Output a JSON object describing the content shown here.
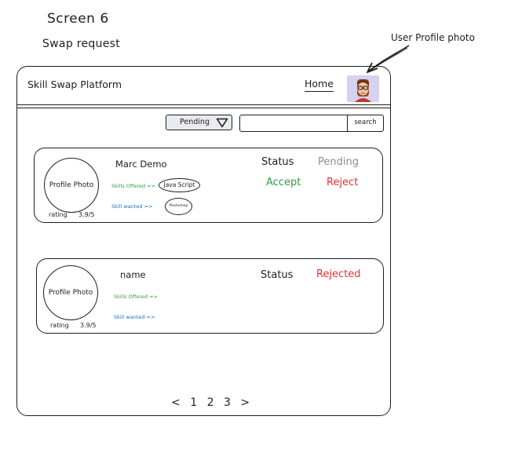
{
  "canvas": {
    "screen_title": "Screen 6",
    "screen_subtitle": "Swap request",
    "annotation": "User Profile photo"
  },
  "header": {
    "app_title": "Skill Swap Platform",
    "home_link": "Home"
  },
  "toolbar": {
    "filter_value": "Pending",
    "search_placeholder": "",
    "search_button": "search"
  },
  "requests": [
    {
      "photo_label": "Profile Photo",
      "rating_label": "rating",
      "rating_value": "3.9/5",
      "name": "Marc Demo",
      "skills_offered_label": "Skills Offered =>",
      "skills_offered_tag": "Java Script",
      "skill_wanted_label": "Skill wanted =>",
      "skill_wanted_tag": "Photoshop",
      "status_label": "Status",
      "status_value": "Pending",
      "accept_label": "Accept",
      "reject_label": "Reject"
    },
    {
      "photo_label": "Profile Photo",
      "rating_label": "rating",
      "rating_value": "3.9/5",
      "name": "name",
      "skills_offered_label": "Skills Offered =>",
      "skill_wanted_label": "Skill wanted =>",
      "status_label": "Status",
      "status_value": "Rejected"
    }
  ],
  "pagination": {
    "prev": "<",
    "pages": [
      "1",
      "2",
      "3"
    ],
    "next": ">"
  },
  "colors": {
    "ink": "#1e1e1e",
    "accept_green": "#2f9e44",
    "reject_red": "#e03131",
    "pending_gray": "#868e96",
    "wanted_blue": "#1971c2",
    "avatar_bg": "#d6d2ef"
  }
}
